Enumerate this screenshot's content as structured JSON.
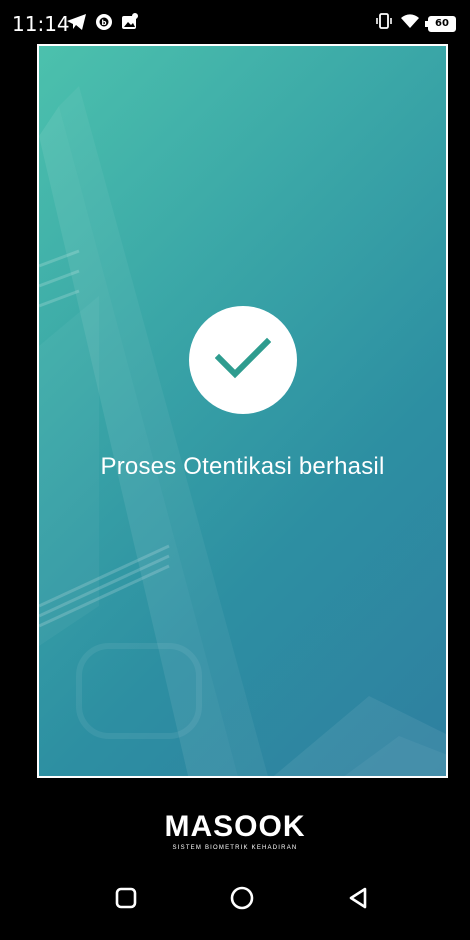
{
  "status_bar": {
    "time": "11:14",
    "battery": "60",
    "left_icons": [
      "telegram-icon",
      "whatsapp-business-icon",
      "gallery-notification-icon"
    ],
    "right_icons": [
      "vibrate-icon",
      "wifi-icon",
      "battery-icon"
    ]
  },
  "preview": {
    "message": "Proses Otentikasi berhasil",
    "accent": "#2e9c8f"
  },
  "logo": {
    "name": "MASOOK",
    "tagline": "SISTEM BIOMETRIK KEHADIRAN"
  },
  "nav": {
    "buttons": [
      "recents-button",
      "home-button",
      "back-button"
    ]
  }
}
